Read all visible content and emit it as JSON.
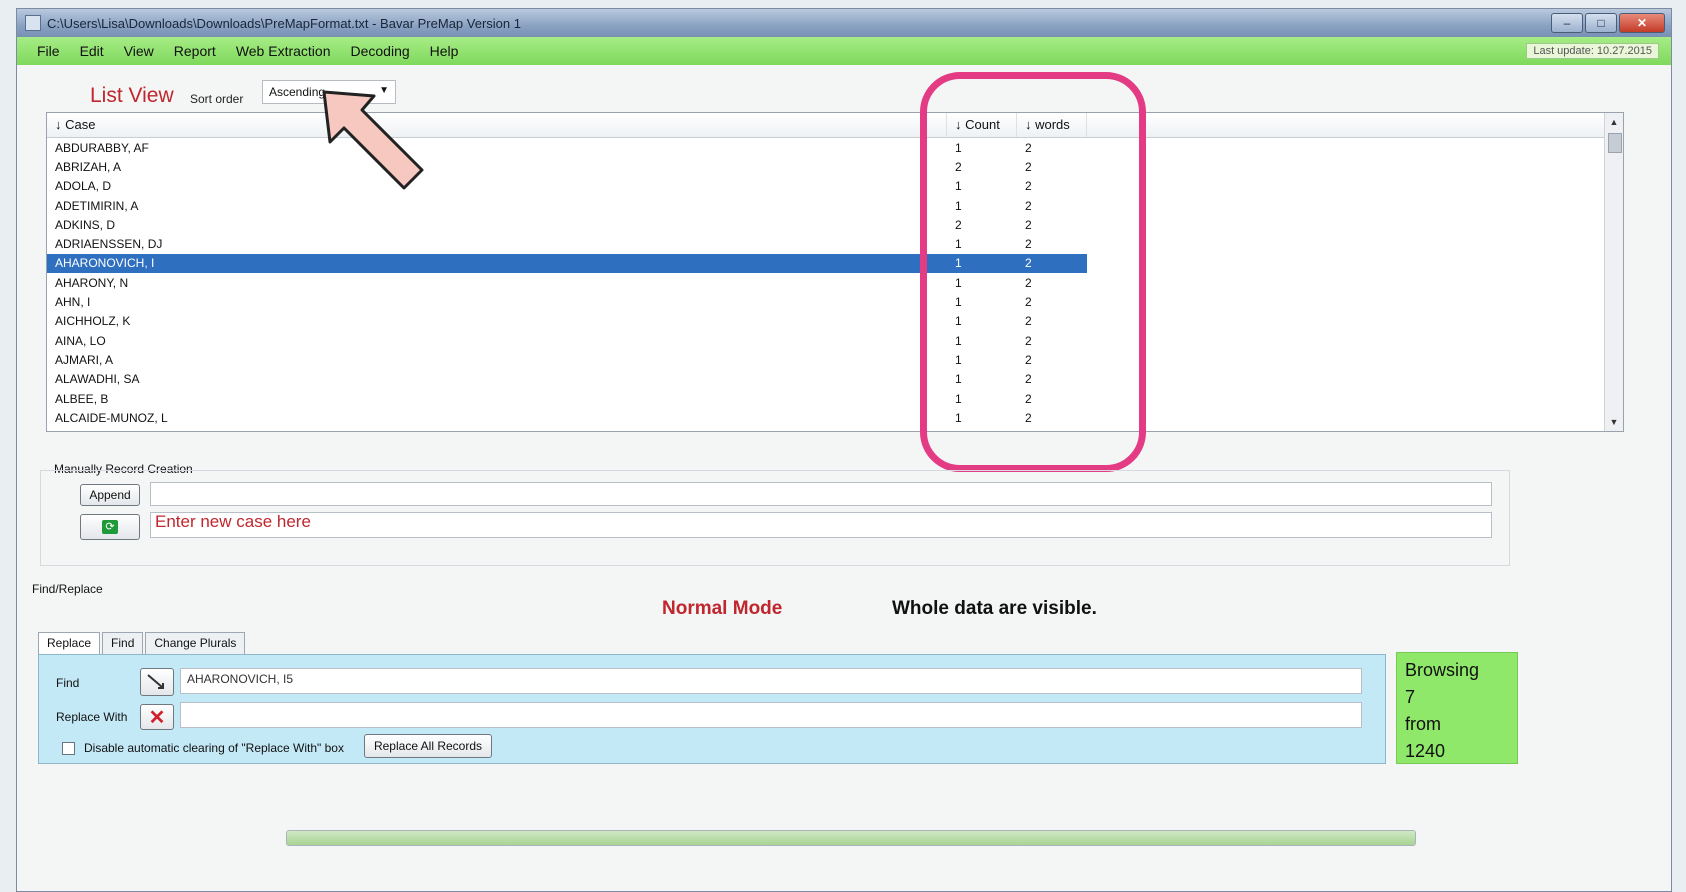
{
  "window": {
    "title": "C:\\Users\\Lisa\\Downloads\\Downloads\\PreMapFormat.txt - Bavar PreMap Version 1"
  },
  "menu": [
    "File",
    "Edit",
    "View",
    "Report",
    "Web Extraction",
    "Decoding",
    "Help"
  ],
  "last_update": "Last update: 10.27.2015",
  "list_view": {
    "label": "List View",
    "sort_label": "Sort order",
    "sort_value": "Ascending",
    "columns": [
      "↓ Case",
      "↓ Count",
      "↓ words"
    ],
    "rows": [
      {
        "case": "ABDURABBY, AF",
        "count": "1",
        "words": "2"
      },
      {
        "case": "ABRIZAH, A",
        "count": "2",
        "words": "2"
      },
      {
        "case": "ADOLA, D",
        "count": "1",
        "words": "2"
      },
      {
        "case": "ADETIMIRIN, A",
        "count": "1",
        "words": "2"
      },
      {
        "case": "ADKINS, D",
        "count": "2",
        "words": "2"
      },
      {
        "case": "ADRIAENSSEN, DJ",
        "count": "1",
        "words": "2"
      },
      {
        "case": "AHARONOVICH, I",
        "count": "1",
        "words": "2"
      },
      {
        "case": "AHARONY, N",
        "count": "1",
        "words": "2"
      },
      {
        "case": "AHN, I",
        "count": "1",
        "words": "2"
      },
      {
        "case": "AICHHOLZ, K",
        "count": "1",
        "words": "2"
      },
      {
        "case": "AINA, LO",
        "count": "1",
        "words": "2"
      },
      {
        "case": "AJMARI, A",
        "count": "1",
        "words": "2"
      },
      {
        "case": "ALAWADHI, SA",
        "count": "1",
        "words": "2"
      },
      {
        "case": "ALBEE, B",
        "count": "1",
        "words": "2"
      },
      {
        "case": "ALCAIDE-MUNOZ, L",
        "count": "1",
        "words": "2"
      }
    ],
    "selected_index": 6
  },
  "manual": {
    "title": "Manually Record Creation",
    "append_label": "Append",
    "new_case_placeholder": "Enter new case here",
    "refresh_icon": "refresh-icon"
  },
  "find_replace": {
    "title": "Find/Replace",
    "mode": "Normal Mode",
    "mode_desc": "Whole data are visible.",
    "tabs": [
      "Replace",
      "Find",
      "Change Plurals"
    ],
    "find_label": "Find",
    "find_value": "AHARONOVICH, I5",
    "replace_label": "Replace With",
    "replace_value": "",
    "checkbox_label": "Disable automatic clearing of \"Replace With\" box",
    "replace_all_label": "Replace All Records"
  },
  "browse": {
    "line1": "Browsing",
    "current": "7",
    "from_label": "from",
    "total": "1240"
  },
  "colors": {
    "menubar": "#8fe06a",
    "accent_red": "#c0262d",
    "highlight": "#e33b84",
    "selection": "#2f6fc0"
  }
}
